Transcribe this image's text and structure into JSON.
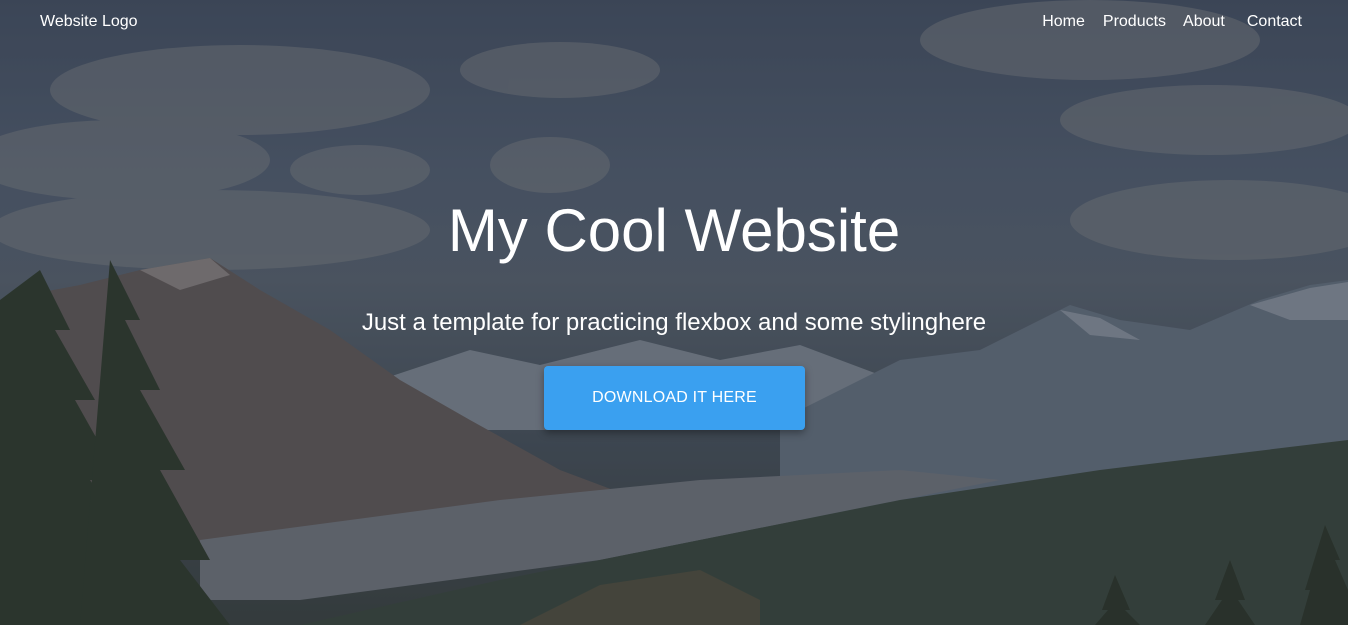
{
  "navbar": {
    "logo": "Website Logo",
    "links": [
      {
        "label": "Home"
      },
      {
        "label": "Products"
      },
      {
        "label": "About"
      },
      {
        "label": "Contact"
      }
    ]
  },
  "hero": {
    "title": "My Cool Website",
    "subtitle": "Just a template for practicing flexbox and some stylinghere",
    "cta_label": "DOWNLOAD IT HERE"
  },
  "colors": {
    "cta_background": "#3aa0f0",
    "overlay": "#282d37",
    "text": "#ffffff"
  }
}
